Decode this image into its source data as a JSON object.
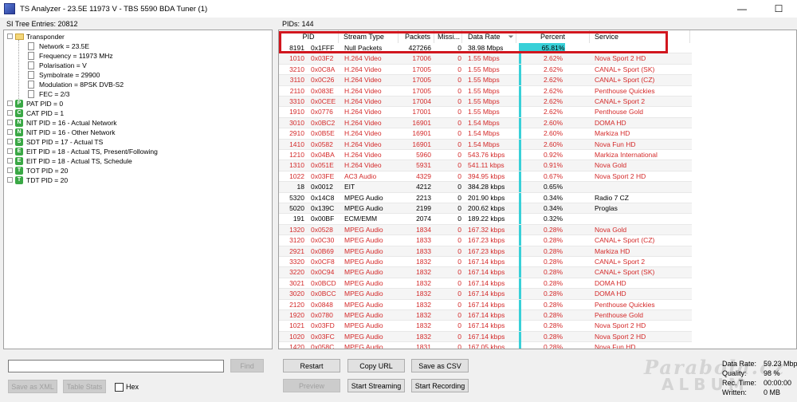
{
  "window": {
    "title": "TS Analyzer - 23.5E 11973 V - TBS 5590 BDA Tuner (1)",
    "minimize": "—",
    "maximize": "☐"
  },
  "left": {
    "header": "SI Tree Entries: 20812",
    "tree": [
      {
        "label": "Transponder",
        "icon": "folder-icon",
        "level": 0,
        "expander": "−"
      },
      {
        "label": "Network = 23.5E",
        "icon": "doc-icon",
        "level": 1
      },
      {
        "label": "Frequency = 11973 MHz",
        "icon": "doc-icon",
        "level": 1
      },
      {
        "label": "Polarisation = V",
        "icon": "doc-icon",
        "level": 1
      },
      {
        "label": "Symbolrate = 29900",
        "icon": "doc-icon",
        "level": 1
      },
      {
        "label": "Modulation = 8PSK DVB-S2",
        "icon": "doc-icon",
        "level": 1
      },
      {
        "label": "FEC = 2/3",
        "icon": "doc-icon",
        "level": 1
      },
      {
        "label": "PAT PID = 0",
        "icon": "badge",
        "badge": "P",
        "level": 0,
        "expander": "+"
      },
      {
        "label": "CAT PID = 1",
        "icon": "badge",
        "badge": "C",
        "level": 0,
        "expander": "+"
      },
      {
        "label": "NIT PID = 16 - Actual Network",
        "icon": "badge",
        "badge": "N",
        "level": 0,
        "expander": "+"
      },
      {
        "label": "NIT PID = 16 - Other Network",
        "icon": "badge",
        "badge": "N",
        "level": 0,
        "expander": "+"
      },
      {
        "label": "SDT PID = 17 - Actual TS",
        "icon": "badge",
        "badge": "S",
        "level": 0,
        "expander": "+"
      },
      {
        "label": "EIT PID = 18 - Actual TS, Present/Following",
        "icon": "badge",
        "badge": "E",
        "level": 0,
        "expander": "+"
      },
      {
        "label": "EIT PID = 18 - Actual TS, Schedule",
        "icon": "badge",
        "badge": "E",
        "level": 0,
        "expander": "+"
      },
      {
        "label": "TOT PID = 20",
        "icon": "badge",
        "badge": "T",
        "level": 0,
        "expander": "+"
      },
      {
        "label": "TDT PID = 20",
        "icon": "badge",
        "badge": "T",
        "level": 0,
        "expander": "+"
      }
    ],
    "search_value": "",
    "find_label": "Find",
    "save_xml_label": "Save as XML",
    "table_stats_label": "Table Stats",
    "hex_label": "Hex"
  },
  "right": {
    "header": "PIDs: 144",
    "columns": [
      "PID",
      "Stream Type",
      "Packets",
      "Missi...",
      "Data Rate",
      "Percent",
      "Service"
    ],
    "sort_arrow": "⏷",
    "rows": [
      {
        "pid": "8191",
        "hex": "0x1FFF",
        "type": "Null Packets",
        "packets": "427266",
        "missing": "0",
        "rate": "38.98 Mbps",
        "percent": "65.81%",
        "pct": 65.81,
        "service": "",
        "red": false
      },
      {
        "pid": "1010",
        "hex": "0x03F2",
        "type": "H.264 Video",
        "packets": "17006",
        "missing": "0",
        "rate": "1.55 Mbps",
        "percent": "2.62%",
        "pct": 2.62,
        "service": "Nova Sport 2 HD",
        "red": true
      },
      {
        "pid": "3210",
        "hex": "0x0C8A",
        "type": "H.264 Video",
        "packets": "17005",
        "missing": "0",
        "rate": "1.55 Mbps",
        "percent": "2.62%",
        "pct": 2.62,
        "service": "CANAL+ Sport (SK)",
        "red": true
      },
      {
        "pid": "3110",
        "hex": "0x0C26",
        "type": "H.264 Video",
        "packets": "17005",
        "missing": "0",
        "rate": "1.55 Mbps",
        "percent": "2.62%",
        "pct": 2.62,
        "service": "CANAL+ Sport (CZ)",
        "red": true
      },
      {
        "pid": "2110",
        "hex": "0x083E",
        "type": "H.264 Video",
        "packets": "17005",
        "missing": "0",
        "rate": "1.55 Mbps",
        "percent": "2.62%",
        "pct": 2.62,
        "service": "Penthouse Quickies",
        "red": true
      },
      {
        "pid": "3310",
        "hex": "0x0CEE",
        "type": "H.264 Video",
        "packets": "17004",
        "missing": "0",
        "rate": "1.55 Mbps",
        "percent": "2.62%",
        "pct": 2.62,
        "service": "CANAL+ Sport 2",
        "red": true
      },
      {
        "pid": "1910",
        "hex": "0x0776",
        "type": "H.264 Video",
        "packets": "17001",
        "missing": "0",
        "rate": "1.55 Mbps",
        "percent": "2.62%",
        "pct": 2.62,
        "service": "Penthouse Gold",
        "red": true
      },
      {
        "pid": "3010",
        "hex": "0x0BC2",
        "type": "H.264 Video",
        "packets": "16901",
        "missing": "0",
        "rate": "1.54 Mbps",
        "percent": "2.60%",
        "pct": 2.6,
        "service": "DOMA HD",
        "red": true
      },
      {
        "pid": "2910",
        "hex": "0x0B5E",
        "type": "H.264 Video",
        "packets": "16901",
        "missing": "0",
        "rate": "1.54 Mbps",
        "percent": "2.60%",
        "pct": 2.6,
        "service": "Markiza HD",
        "red": true
      },
      {
        "pid": "1410",
        "hex": "0x0582",
        "type": "H.264 Video",
        "packets": "16901",
        "missing": "0",
        "rate": "1.54 Mbps",
        "percent": "2.60%",
        "pct": 2.6,
        "service": "Nova Fun HD",
        "red": true
      },
      {
        "pid": "1210",
        "hex": "0x04BA",
        "type": "H.264 Video",
        "packets": "5960",
        "missing": "0",
        "rate": "543.76 kbps",
        "percent": "0.92%",
        "pct": 0.92,
        "service": "Markiza International",
        "red": true
      },
      {
        "pid": "1310",
        "hex": "0x051E",
        "type": "H.264 Video",
        "packets": "5931",
        "missing": "0",
        "rate": "541.11 kbps",
        "percent": "0.91%",
        "pct": 0.91,
        "service": "Nova Gold",
        "red": true
      },
      {
        "pid": "1022",
        "hex": "0x03FE",
        "type": "AC3 Audio",
        "packets": "4329",
        "missing": "0",
        "rate": "394.95 kbps",
        "percent": "0.67%",
        "pct": 0.67,
        "service": "Nova Sport 2 HD",
        "red": true
      },
      {
        "pid": "18",
        "hex": "0x0012",
        "type": "EIT",
        "packets": "4212",
        "missing": "0",
        "rate": "384.28 kbps",
        "percent": "0.65%",
        "pct": 0.65,
        "service": "",
        "red": false
      },
      {
        "pid": "5320",
        "hex": "0x14C8",
        "type": "MPEG Audio",
        "packets": "2213",
        "missing": "0",
        "rate": "201.90 kbps",
        "percent": "0.34%",
        "pct": 0.34,
        "service": "Radio 7 CZ",
        "red": false
      },
      {
        "pid": "5020",
        "hex": "0x139C",
        "type": "MPEG Audio",
        "packets": "2199",
        "missing": "0",
        "rate": "200.62 kbps",
        "percent": "0.34%",
        "pct": 0.34,
        "service": "Proglas",
        "red": false
      },
      {
        "pid": "191",
        "hex": "0x00BF",
        "type": "ECM/EMM",
        "packets": "2074",
        "missing": "0",
        "rate": "189.22 kbps",
        "percent": "0.32%",
        "pct": 0.32,
        "service": "",
        "red": false
      },
      {
        "pid": "1320",
        "hex": "0x0528",
        "type": "MPEG Audio",
        "packets": "1834",
        "missing": "0",
        "rate": "167.32 kbps",
        "percent": "0.28%",
        "pct": 0.28,
        "service": "Nova Gold",
        "red": true
      },
      {
        "pid": "3120",
        "hex": "0x0C30",
        "type": "MPEG Audio",
        "packets": "1833",
        "missing": "0",
        "rate": "167.23 kbps",
        "percent": "0.28%",
        "pct": 0.28,
        "service": "CANAL+ Sport (CZ)",
        "red": true
      },
      {
        "pid": "2921",
        "hex": "0x0B69",
        "type": "MPEG Audio",
        "packets": "1833",
        "missing": "0",
        "rate": "167.23 kbps",
        "percent": "0.28%",
        "pct": 0.28,
        "service": "Markiza HD",
        "red": true
      },
      {
        "pid": "3320",
        "hex": "0x0CF8",
        "type": "MPEG Audio",
        "packets": "1832",
        "missing": "0",
        "rate": "167.14 kbps",
        "percent": "0.28%",
        "pct": 0.28,
        "service": "CANAL+ Sport 2",
        "red": true
      },
      {
        "pid": "3220",
        "hex": "0x0C94",
        "type": "MPEG Audio",
        "packets": "1832",
        "missing": "0",
        "rate": "167.14 kbps",
        "percent": "0.28%",
        "pct": 0.28,
        "service": "CANAL+ Sport (SK)",
        "red": true
      },
      {
        "pid": "3021",
        "hex": "0x0BCD",
        "type": "MPEG Audio",
        "packets": "1832",
        "missing": "0",
        "rate": "167.14 kbps",
        "percent": "0.28%",
        "pct": 0.28,
        "service": "DOMA HD",
        "red": true
      },
      {
        "pid": "3020",
        "hex": "0x0BCC",
        "type": "MPEG Audio",
        "packets": "1832",
        "missing": "0",
        "rate": "167.14 kbps",
        "percent": "0.28%",
        "pct": 0.28,
        "service": "DOMA HD",
        "red": true
      },
      {
        "pid": "2120",
        "hex": "0x0848",
        "type": "MPEG Audio",
        "packets": "1832",
        "missing": "0",
        "rate": "167.14 kbps",
        "percent": "0.28%",
        "pct": 0.28,
        "service": "Penthouse Quickies",
        "red": true
      },
      {
        "pid": "1920",
        "hex": "0x0780",
        "type": "MPEG Audio",
        "packets": "1832",
        "missing": "0",
        "rate": "167.14 kbps",
        "percent": "0.28%",
        "pct": 0.28,
        "service": "Penthouse Gold",
        "red": true
      },
      {
        "pid": "1021",
        "hex": "0x03FD",
        "type": "MPEG Audio",
        "packets": "1832",
        "missing": "0",
        "rate": "167.14 kbps",
        "percent": "0.28%",
        "pct": 0.28,
        "service": "Nova Sport 2 HD",
        "red": true
      },
      {
        "pid": "1020",
        "hex": "0x03FC",
        "type": "MPEG Audio",
        "packets": "1832",
        "missing": "0",
        "rate": "167.14 kbps",
        "percent": "0.28%",
        "pct": 0.28,
        "service": "Nova Sport 2 HD",
        "red": true
      },
      {
        "pid": "1420",
        "hex": "0x058C",
        "type": "MPEG Audio",
        "packets": "1831",
        "missing": "0",
        "rate": "167.05 kbps",
        "percent": "0.28%",
        "pct": 0.28,
        "service": "Nova Fun HD",
        "red": true
      }
    ],
    "buttons": {
      "restart": "Restart",
      "copy_url": "Copy URL",
      "save_csv": "Save as CSV",
      "preview": "Preview",
      "start_streaming": "Start Streaming",
      "start_recording": "Start Recording"
    },
    "stats": {
      "data_rate_label": "Data Rate:",
      "data_rate": "59.23 Mbp",
      "quality_label": "Quality:",
      "quality": "98 %",
      "rec_time_label": "Rec. Time:",
      "rec_time": "00:00:00",
      "written_label": "Written:",
      "written": "0 MB"
    }
  },
  "colors": {
    "accent_red": "#d42a2a",
    "percent_bar": "#38d0d8",
    "highlight_box": "#d1161e"
  }
}
